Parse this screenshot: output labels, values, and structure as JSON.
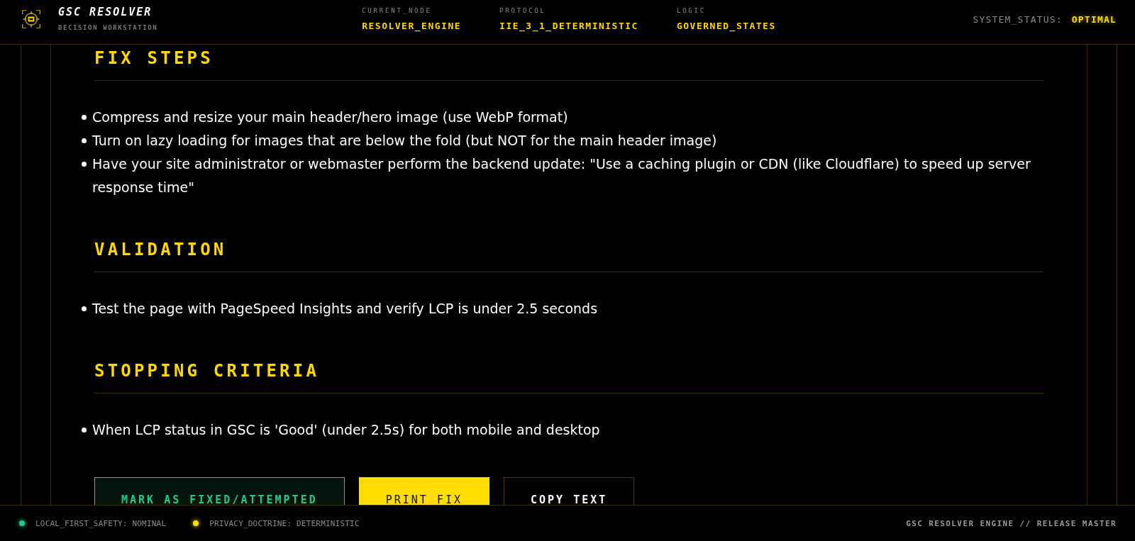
{
  "header": {
    "title": "GSC RESOLVER",
    "subtitle": "DECISION WORKSTATION",
    "fields": [
      {
        "label": "CURRENT_NODE",
        "value": "RESOLVER_ENGINE"
      },
      {
        "label": "PROTOCOL",
        "value": "IIE_3_1_DETERMINISTIC"
      },
      {
        "label": "LOGIC",
        "value": "GOVERNED_STATES"
      }
    ],
    "status_label": "SYSTEM_STATUS:",
    "status_value": "OPTIMAL"
  },
  "sections": [
    {
      "heading": "FIX STEPS",
      "items": [
        "Compress and resize your main header/hero image (use WebP format)",
        "Turn on lazy loading for images that are below the fold (but NOT for the main header image)",
        "Have your site administrator or webmaster perform the backend update: \"Use a caching plugin or CDN (like Cloudflare) to speed up server response time\""
      ]
    },
    {
      "heading": "VALIDATION",
      "items": [
        "Test the page with PageSpeed Insights and verify LCP is under 2.5 seconds"
      ]
    },
    {
      "heading": "STOPPING CRITERIA",
      "items": [
        "When LCP status in GSC is 'Good' (under 2.5s) for both mobile and desktop"
      ]
    }
  ],
  "buttons": [
    {
      "label": "MARK AS FIXED/ATTEMPTED",
      "kind": "success"
    },
    {
      "label": "PRINT FIX",
      "kind": "primary"
    },
    {
      "label": "COPY TEXT",
      "kind": "outline"
    }
  ],
  "footer": {
    "indicators": [
      {
        "label": "LOCAL_FIRST_SAFETY: NOMINAL",
        "color": "#1ec98f"
      },
      {
        "label": "PRIVACY_DOCTRINE: DETERMINISTIC",
        "color": "#ffdd00"
      }
    ],
    "release": "GSC RESOLVER ENGINE // RELEASE MASTER"
  }
}
